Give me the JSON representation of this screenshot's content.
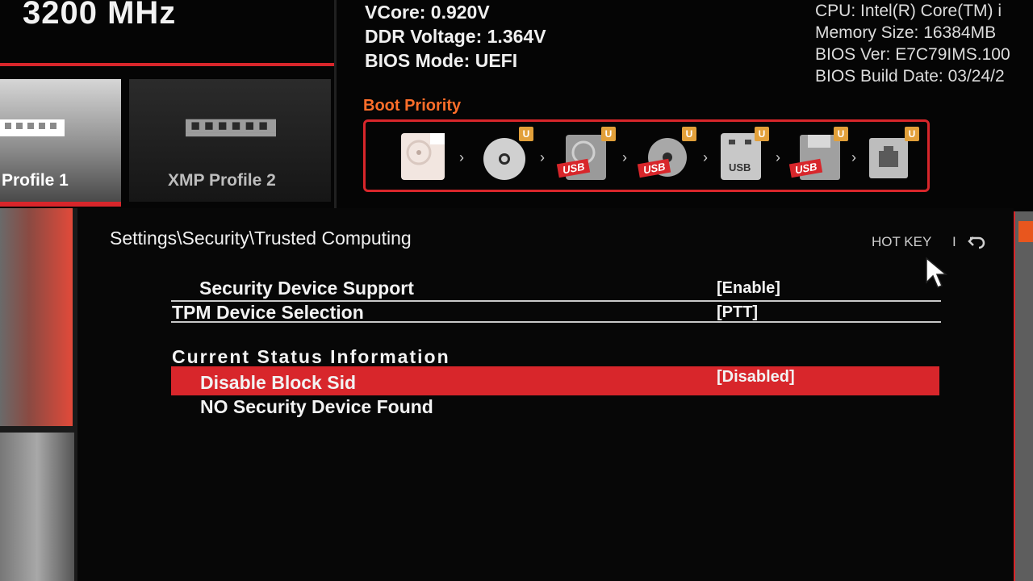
{
  "top": {
    "memory_frequency": "3200 MHz",
    "voltages": [
      "VCore: 0.920V",
      "DDR Voltage: 1.364V",
      "BIOS Mode: UEFI"
    ],
    "system_info": [
      "CPU: Intel(R) Core(TM) i",
      "Memory Size: 16384MB",
      "BIOS Ver: E7C79IMS.100",
      "BIOS Build Date: 03/24/2"
    ]
  },
  "profiles": [
    {
      "label": "Profile 1",
      "active": true
    },
    {
      "label": "XMP Profile 2",
      "active": false
    }
  ],
  "boot_priority": {
    "label": "Boot Priority",
    "devices": [
      {
        "icon": "hard-disk-icon",
        "usb": false,
        "badge": ""
      },
      {
        "icon": "optical-disc-icon",
        "usb": false,
        "badge": "U"
      },
      {
        "icon": "usb-hard-disk-icon",
        "usb": true,
        "badge": "U"
      },
      {
        "icon": "usb-optical-disc-icon",
        "usb": true,
        "badge": "U"
      },
      {
        "icon": "usb-key-icon",
        "usb": false,
        "badge": "U",
        "sublabel": "USB"
      },
      {
        "icon": "usb-floppy-icon",
        "usb": true,
        "badge": "U"
      },
      {
        "icon": "network-icon",
        "usb": false,
        "badge": "U"
      }
    ],
    "usb_tag": "USB"
  },
  "header": {
    "breadcrumb": "Settings\\Security\\Trusted Computing",
    "hotkey_label": "HOT KEY",
    "separator": "I"
  },
  "settings": [
    {
      "label": "Security Device Support",
      "value": "[Enable]"
    },
    {
      "label": "TPM Device Selection",
      "value": "[PTT]"
    }
  ],
  "status_section": {
    "title": "Current Status Information",
    "items": [
      {
        "label": "Disable Block Sid",
        "value": "[Disabled]",
        "selected": true
      },
      {
        "label": "NO Security Device Found",
        "value": ""
      }
    ]
  },
  "colors": {
    "accent_red": "#d8262b",
    "boot_label_orange": "#ff6e2a",
    "background": "#050505"
  }
}
